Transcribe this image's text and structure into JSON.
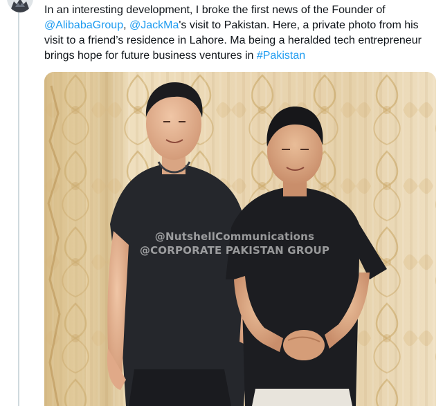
{
  "tweet": {
    "text_1": "In an interesting development, I broke the first news of the Founder of ",
    "mention_1": "@AlibabaGroup",
    "text_2": ", ",
    "mention_2": "@JackMa",
    "text_3": "'s visit to Pakistan. Here, a private photo from his visit to a friend’s residence in Lahore. Ma being a heralded tech entrepreneur brings hope for future business ventures in ",
    "hashtag": "#Pakistan"
  },
  "media": {
    "watermark_line_1": "@NutshellCommunications",
    "watermark_line_2": "@CORPORATE PAKISTAN GROUP"
  },
  "colors": {
    "link": "#1d9bf0",
    "text": "#0f1419",
    "thread_line": "#cfd9de"
  }
}
